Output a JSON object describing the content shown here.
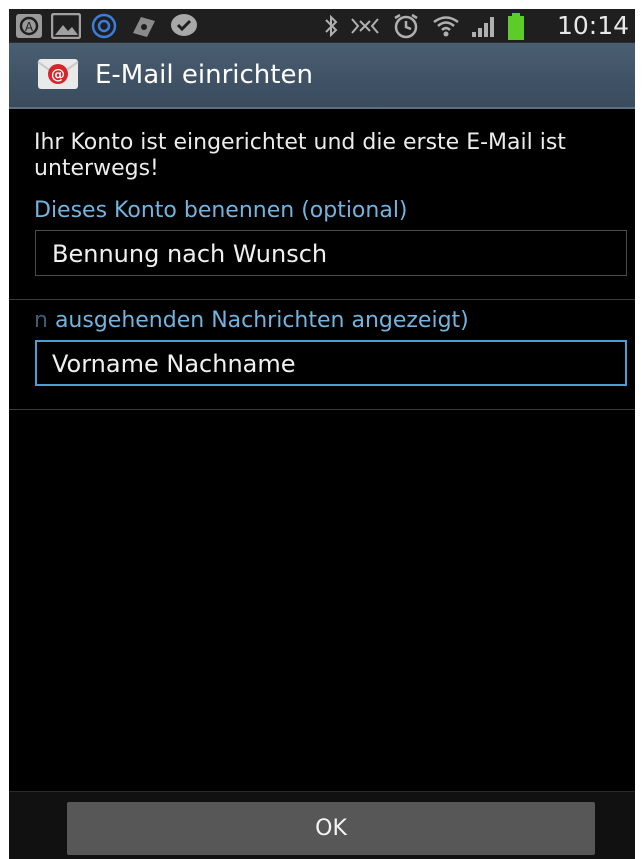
{
  "status_bar": {
    "time": "10:14",
    "icons_left": [
      "android-icon",
      "gallery-icon",
      "sync-icon",
      "maps-icon",
      "checkmark-icon"
    ],
    "icons_right": [
      "bluetooth-icon",
      "nfc-icon",
      "alarm-icon",
      "wifi-icon",
      "signal-icon",
      "battery-icon"
    ],
    "battery_color": "#5dcb2a"
  },
  "header": {
    "title": "E-Mail einrichten",
    "icon": "email-app-icon"
  },
  "content": {
    "message": "Ihr Konto ist eingerichtet und die erste E-Mail ist unterwegs!",
    "account_name_label": "Dieses Konto benennen (optional)",
    "account_name_value": "Bennung nach Wunsch",
    "sender_name_label_faded": "n",
    "sender_name_label": " ausgehenden Nachrichten angezeigt)",
    "sender_name_value": "Vorname Nachname"
  },
  "footer": {
    "ok_label": "OK"
  },
  "colors": {
    "accent": "#73b3dd",
    "focus_border": "#4a9ed6",
    "titlebar": "#4a5e72"
  }
}
